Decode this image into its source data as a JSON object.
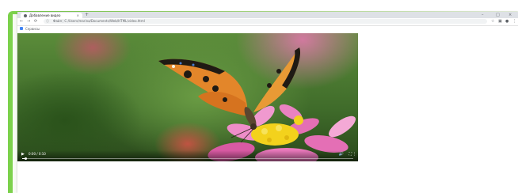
{
  "browser": {
    "tab_title": "Добавление видео",
    "tab_close": "×",
    "new_tab": "+",
    "window_controls": {
      "minimize": "–",
      "maximize": "□",
      "close": "×"
    },
    "nav": {
      "back": "←",
      "forward": "→",
      "reload": "⟳"
    },
    "address": {
      "info": "ⓘ",
      "scheme": "Файл",
      "url": "C:/Users/marina/Documents/Web/HTML/video.html"
    },
    "toolbar_icons": {
      "star": "☆",
      "extensions": "▣",
      "profile": "●",
      "menu": "⋮"
    }
  },
  "bookmarks": {
    "apps_label": "Сервисы"
  },
  "video": {
    "time_text": "0:00 / 0:10",
    "progress": 0.01,
    "icons": {
      "play": "▶",
      "volume": "🔊",
      "fullscreen": "⛶",
      "more": "⋮"
    }
  },
  "colors": {
    "frame_green": "#7bd14b",
    "butterfly_orange": "#e3862a",
    "flower_pink": "#e46fb5",
    "flower_yellow": "#f3d21c"
  }
}
